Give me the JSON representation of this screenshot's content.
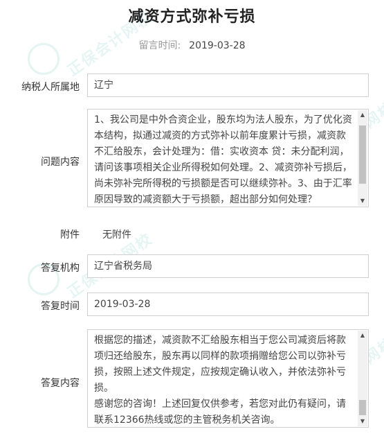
{
  "title": "减资方式弥补亏损",
  "message_time_label": "留言时间:",
  "message_time": "2019-03-28",
  "fields": {
    "taxpayer_location": {
      "label": "纳税人所属地",
      "value": "辽宁"
    },
    "question": {
      "label": "问题内容",
      "value": "1、我公司是中外合资企业，股东均为法人股东，为了优化资本结构，拟通过减资的方式弥补以前年度累计亏损，减资款不汇给股东，会计处理为：借：实收资本 贷：未分配利润，请问该事项相关企业所得税如何处理。2、减资弥补亏损后，尚未弥补完所得税的亏损额是否可以继续弥补。3、由于汇率原因导致的减资额大于亏损额，超出部分如何处理？"
    },
    "attachment": {
      "label": "附件",
      "value": "无附件"
    },
    "reply_org": {
      "label": "答复机构",
      "value": "辽宁省税务局"
    },
    "reply_time": {
      "label": "答复时间",
      "value": "2019-03-28"
    },
    "reply_content": {
      "label": "答复内容",
      "value": "根据您的描述，减资款不汇给股东相当于您公司减资后将款项归还给股东，股东再以同样的款项捐赠给您公司以弥补亏损，按照上述文件规定，应按规定确认收入，并依法弥补亏损。\n感谢您的咨询！上述回复仅供参考，若您对此仍有疑问，请联系12366热线或您的主管税务机关咨询。"
    }
  },
  "scroll": {
    "question_thumb_position": 0.1,
    "reply_thumb_position": 0.9
  },
  "watermark": {
    "text": "正保会计网校",
    "subtext": "www.chinaacc.com",
    "color": "#3cb4aa"
  }
}
